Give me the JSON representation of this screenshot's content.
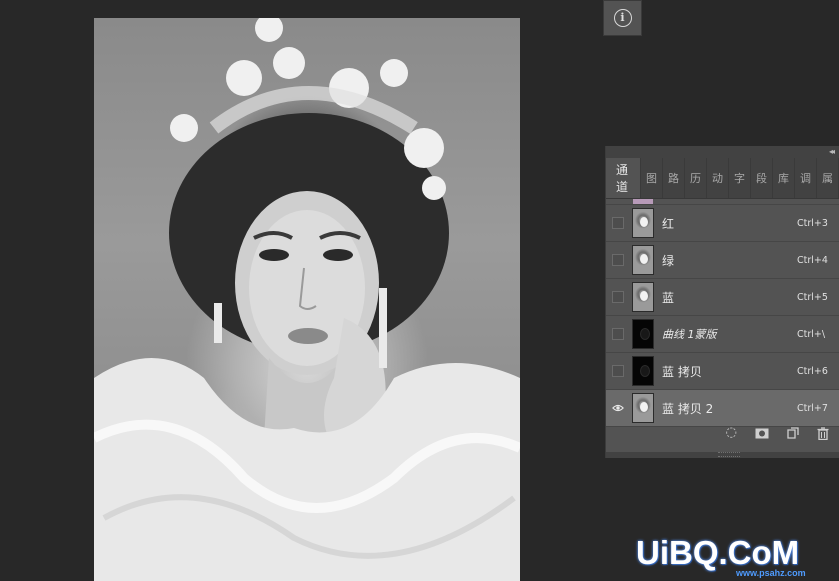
{
  "info_button": {
    "icon": "info-icon",
    "glyph": "i"
  },
  "panel": {
    "collapse_glyph": "◂◂",
    "tabs": [
      {
        "label": "通道",
        "active": true
      },
      {
        "label": "图"
      },
      {
        "label": "路"
      },
      {
        "label": "历"
      },
      {
        "label": "动"
      },
      {
        "label": "字"
      },
      {
        "label": "段"
      },
      {
        "label": "库"
      },
      {
        "label": "调"
      },
      {
        "label": "属"
      }
    ],
    "channels": [
      {
        "name": "红",
        "shortcut": "Ctrl+3",
        "visible": false,
        "thumb": "gray",
        "selected": false,
        "italic": false
      },
      {
        "name": "绿",
        "shortcut": "Ctrl+4",
        "visible": false,
        "thumb": "gray",
        "selected": false,
        "italic": false
      },
      {
        "name": "蓝",
        "shortcut": "Ctrl+5",
        "visible": false,
        "thumb": "gray",
        "selected": false,
        "italic": false
      },
      {
        "name": "曲线 1蒙版",
        "shortcut": "Ctrl+\\",
        "visible": false,
        "thumb": "dark",
        "selected": false,
        "italic": true
      },
      {
        "name": "蓝 拷贝",
        "shortcut": "Ctrl+6",
        "visible": false,
        "thumb": "dark",
        "selected": false,
        "italic": false
      },
      {
        "name": "蓝 拷贝 2",
        "shortcut": "Ctrl+7",
        "visible": true,
        "thumb": "gray",
        "selected": true,
        "italic": false
      }
    ],
    "footer_icons": [
      "dotted-circle-selection-icon",
      "save-selection-as-channel-icon",
      "new-channel-icon",
      "trash-icon"
    ],
    "footer_glyphs": [
      "◌",
      "◙",
      "⊐",
      "🗑"
    ]
  },
  "watermark": {
    "logo": "UiBQ.CoM",
    "url": "www.psahz.com"
  },
  "colors": {
    "panel_bg": "#535353",
    "selected_row": "#6a6a6a",
    "workspace_bg": "#282828",
    "watermark_blue": "#4f9cff"
  }
}
